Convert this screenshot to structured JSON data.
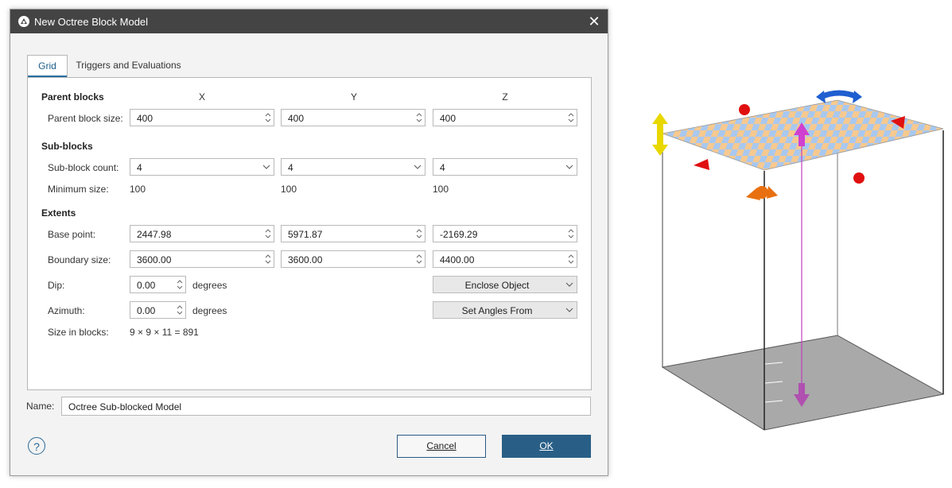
{
  "window": {
    "title": "New Octree Block Model",
    "icon": "app-logo-icon",
    "close_icon": "close-icon"
  },
  "tabs": [
    {
      "label": "Grid",
      "active": true
    },
    {
      "label": "Triggers and Evaluations",
      "active": false
    }
  ],
  "grid": {
    "columns": [
      "X",
      "Y",
      "Z"
    ],
    "parent_blocks": {
      "heading": "Parent blocks",
      "size_label": "Parent block size:",
      "values": [
        "400",
        "400",
        "400"
      ]
    },
    "sub_blocks": {
      "heading": "Sub-blocks",
      "count_label": "Sub-block count:",
      "counts": [
        "4",
        "4",
        "4"
      ],
      "minimum_label": "Minimum size:",
      "minimum": [
        "100",
        "100",
        "100"
      ]
    },
    "extents": {
      "heading": "Extents",
      "base_point_label": "Base point:",
      "base_point": [
        "2447.98",
        "5971.87",
        "-2169.29"
      ],
      "boundary_label": "Boundary size:",
      "boundary": [
        "3600.00",
        "3600.00",
        "4400.00"
      ],
      "dip_label": "Dip:",
      "dip_value": "0.00",
      "dip_unit": "degrees",
      "azimuth_label": "Azimuth:",
      "azimuth_value": "0.00",
      "azimuth_unit": "degrees",
      "enclose_button": "Enclose Object",
      "set_angles_button": "Set Angles From",
      "size_in_blocks_label": "Size in blocks:",
      "size_in_blocks_value": "9 × 9 × 11 = 891"
    }
  },
  "name": {
    "label": "Name:",
    "value": "Octree Sub-blocked Model"
  },
  "buttons": {
    "cancel": "Cancel",
    "ok": "OK",
    "help": "?"
  },
  "colors": {
    "title_bar": "#444444",
    "accent": "#295f86",
    "plane_orange": "#f7c98f",
    "plane_blue": "#a8c8f0",
    "box_floor": "#a9a9a9"
  }
}
